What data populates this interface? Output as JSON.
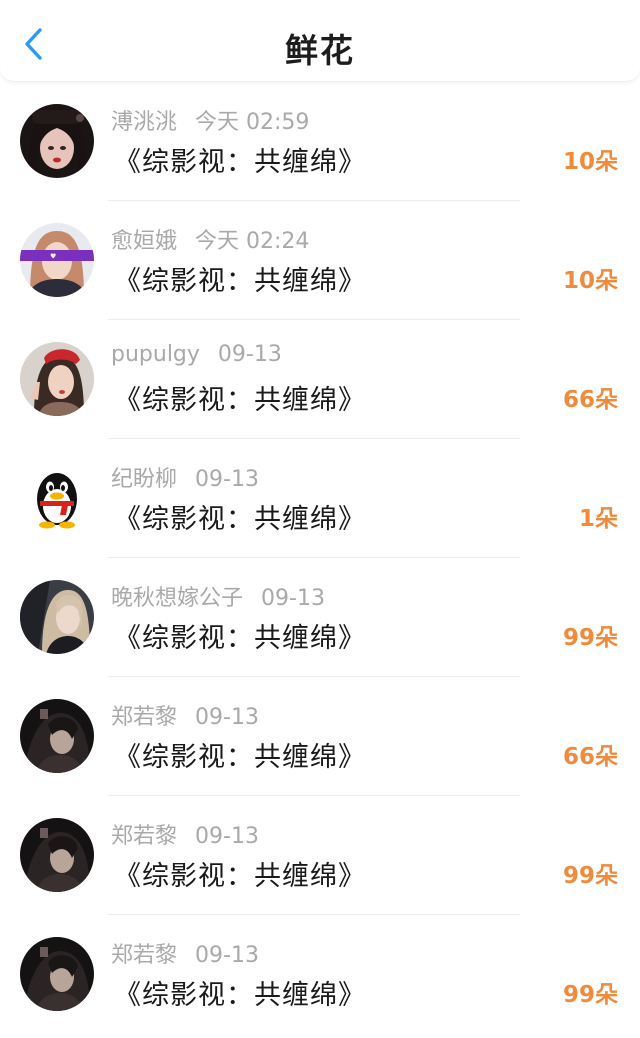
{
  "header": {
    "title": "鲜花"
  },
  "colors": {
    "accent_back": "#2b9af3",
    "count_orange": "#f08a3c",
    "meta_gray": "#a9a9a9"
  },
  "rows": [
    {
      "name": "溥洮洮",
      "time": "今天 02:59",
      "book": "《综影视：共缠绵》",
      "count": "10朵",
      "avatar": "avatar-girl-dark-hair"
    },
    {
      "name": "愈姮娥",
      "time": "今天 02:24",
      "book": "《综影视：共缠绵》",
      "count": "10朵",
      "avatar": "avatar-girl-purple-banner"
    },
    {
      "name": "pupulgy",
      "time": "09-13",
      "book": "《综影视：共缠绵》",
      "count": "66朵",
      "avatar": "avatar-girl-red-hat"
    },
    {
      "name": "纪盼柳",
      "time": "09-13",
      "book": "《综影视：共缠绵》",
      "count": "1朵",
      "avatar": "qq-penguin-avatar"
    },
    {
      "name": "晚秋想嫁公子",
      "time": "09-13",
      "book": "《综影视：共缠绵》",
      "count": "99朵",
      "avatar": "avatar-girl-blonde"
    },
    {
      "name": "郑若黎",
      "time": "09-13",
      "book": "《综影视：共缠绵》",
      "count": "66朵",
      "avatar": "avatar-dark-portrait"
    },
    {
      "name": "郑若黎",
      "time": "09-13",
      "book": "《综影视：共缠绵》",
      "count": "99朵",
      "avatar": "avatar-dark-portrait"
    },
    {
      "name": "郑若黎",
      "time": "09-13",
      "book": "《综影视：共缠绵》",
      "count": "99朵",
      "avatar": "avatar-dark-portrait"
    }
  ]
}
